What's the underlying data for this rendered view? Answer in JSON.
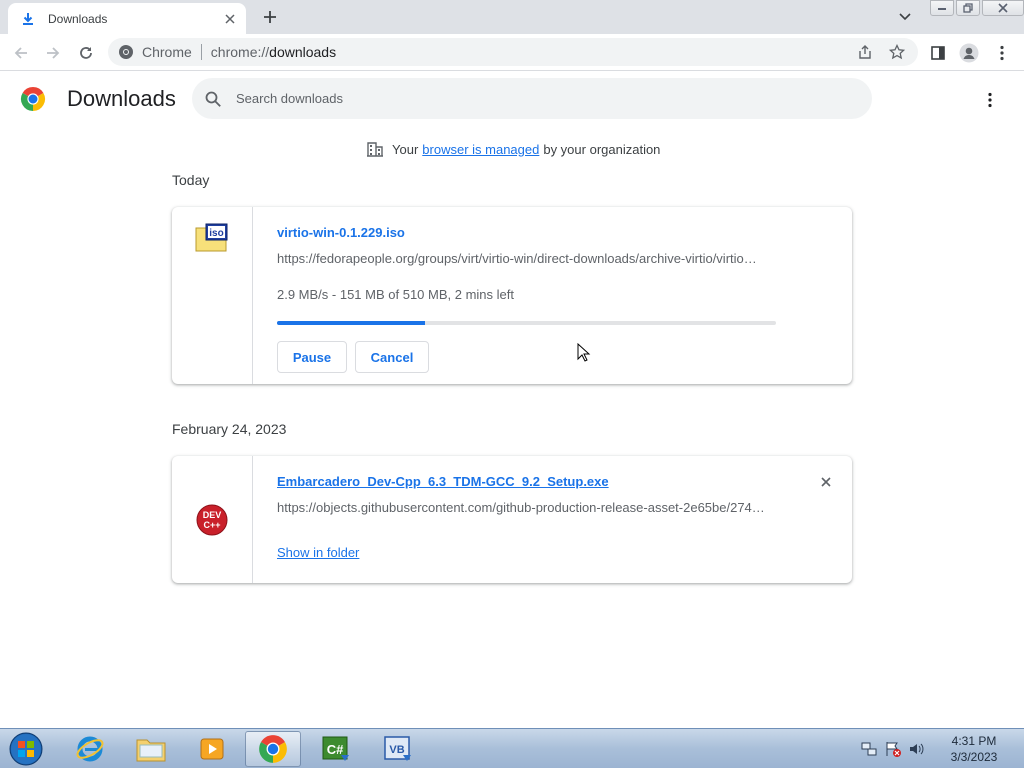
{
  "browser": {
    "tab": {
      "title": "Downloads"
    },
    "omnibox": {
      "site_chip": "Chrome",
      "url_scheme": "chrome://",
      "url_path": "downloads"
    }
  },
  "downloads_page": {
    "title": "Downloads",
    "search": {
      "placeholder": "Search downloads",
      "value": ""
    },
    "managed_notice": {
      "prefix": "Your",
      "link": "browser is managed",
      "suffix": "by your organization"
    },
    "sections": [
      {
        "date": "Today",
        "item": {
          "file_name": "virtio-win-0.1.229.iso",
          "url": "https://fedorapeople.org/groups/virt/virtio-win/direct-downloads/archive-virtio/virtio…",
          "status": "2.9 MB/s - 151 MB of 510 MB, 2 mins left",
          "progress_fraction": 0.296,
          "icon": "iso-file-icon",
          "actions": {
            "pause": "Pause",
            "cancel": "Cancel"
          }
        }
      },
      {
        "date": "February 24, 2023",
        "item": {
          "file_name": "Embarcadero_Dev-Cpp_6.3_TDM-GCC_9.2_Setup.exe",
          "url": "https://objects.githubusercontent.com/github-production-release-asset-2e65be/274…",
          "icon": "devcpp-icon",
          "icon_text": "DEV C++",
          "actions": {
            "show_in_folder": "Show in folder"
          }
        }
      }
    ]
  },
  "taskbar": {
    "items": [
      "start-orb",
      "internet-explorer",
      "file-explorer",
      "media-player",
      "chrome",
      "csharp-app",
      "vb-app"
    ],
    "active": "chrome",
    "clock": {
      "time": "4:31 PM",
      "date": "3/3/2023"
    }
  },
  "colors": {
    "accent": "#1a73e8",
    "progress_track": "#e2e3e5",
    "tab_strip": "#dee1e6"
  }
}
